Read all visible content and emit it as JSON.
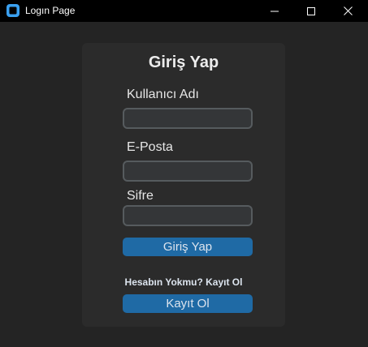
{
  "window": {
    "title": "Logın Page",
    "app_icon": "app-window-icon",
    "controls": {
      "minimize": "minimize-icon",
      "maximize": "maximize-icon",
      "close": "close-icon"
    }
  },
  "form": {
    "heading": "Giriş Yap",
    "username_label": "Kullanıcı Adı",
    "username_value": "",
    "email_label": "E-Posta",
    "email_value": "",
    "password_label": "Sifre",
    "password_value": "",
    "login_button": "Giriş Yap",
    "signup_prompt": "Hesabın Yokmu? Kayıt Ol",
    "signup_button": "Kayıt Ol"
  },
  "colors": {
    "background": "#242424",
    "frame": "#2b2b2b",
    "accent": "#1f6aa5",
    "entry_background": "#343638",
    "entry_border": "#565b5e"
  }
}
